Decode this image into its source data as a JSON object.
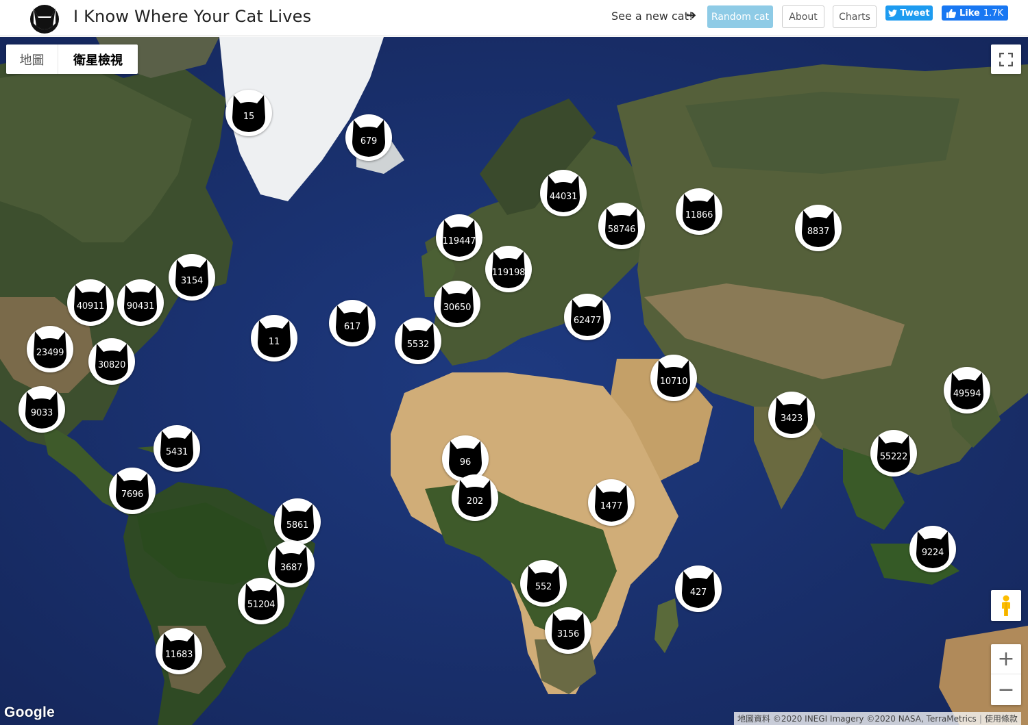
{
  "header": {
    "title": "I Know Where Your Cat Lives",
    "see_new": "See a new cat!",
    "random_cat": "Random cat",
    "about": "About",
    "charts": "Charts",
    "tweet": "Tweet",
    "like": "Like",
    "like_count": "1.7K"
  },
  "map": {
    "type_map": "地圖",
    "type_satellite": "衛星檢視",
    "google": "Google",
    "attribution": "地圖資料 ©2020 INEGI Imagery ©2020 NASA, TerraMetrics",
    "terms": "使用條款",
    "icons": {
      "fullscreen": "fullscreen-icon",
      "pegman": "pegman-icon",
      "zoom_in": "+",
      "zoom_out": "−"
    }
  },
  "clusters": [
    {
      "count": "15"
    },
    {
      "count": "679"
    },
    {
      "count": "44031"
    },
    {
      "count": "11866"
    },
    {
      "count": "58746"
    },
    {
      "count": "8837"
    },
    {
      "count": "119447"
    },
    {
      "count": "119198"
    },
    {
      "count": "3154"
    },
    {
      "count": "40911"
    },
    {
      "count": "90431"
    },
    {
      "count": "30650"
    },
    {
      "count": "62477"
    },
    {
      "count": "617"
    },
    {
      "count": "11"
    },
    {
      "count": "5532"
    },
    {
      "count": "23499"
    },
    {
      "count": "30820"
    },
    {
      "count": "10710"
    },
    {
      "count": "49594"
    },
    {
      "count": "9033"
    },
    {
      "count": "3423"
    },
    {
      "count": "5431"
    },
    {
      "count": "55222"
    },
    {
      "count": "96"
    },
    {
      "count": "7696"
    },
    {
      "count": "202"
    },
    {
      "count": "1477"
    },
    {
      "count": "5861"
    },
    {
      "count": "9224"
    },
    {
      "count": "3687"
    },
    {
      "count": "552"
    },
    {
      "count": "427"
    },
    {
      "count": "51204"
    },
    {
      "count": "3156"
    },
    {
      "count": "11683"
    }
  ]
}
